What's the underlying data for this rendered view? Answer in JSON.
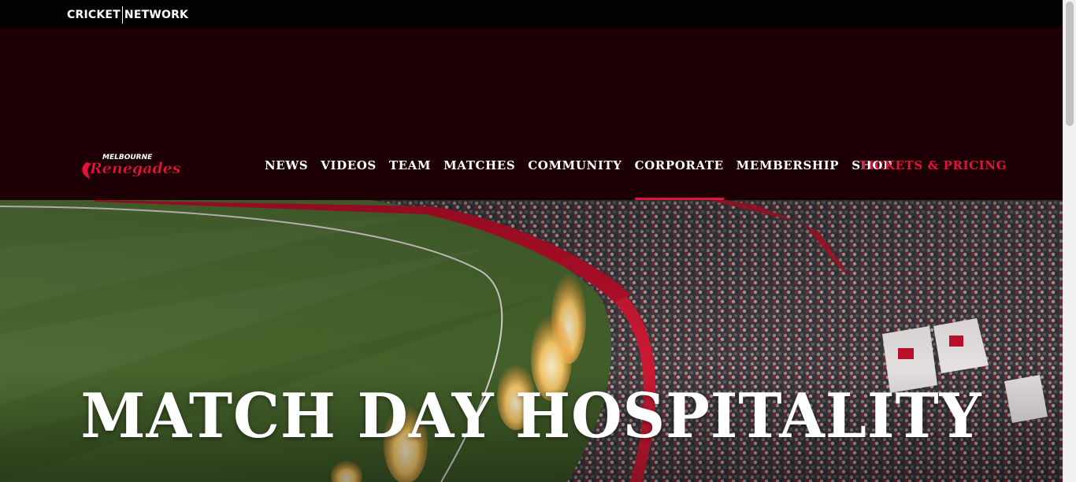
{
  "network_bar": {
    "logo_left": "CRICKET",
    "logo_right": "NETWORK"
  },
  "header": {
    "club_logo_top": "MELBOURNE",
    "club_logo_main": "Renegades",
    "nav": [
      {
        "label": "NEWS"
      },
      {
        "label": "VIDEOS"
      },
      {
        "label": "TEAM"
      },
      {
        "label": "MATCHES"
      },
      {
        "label": "COMMUNITY"
      },
      {
        "label": "CORPORATE",
        "active": true
      },
      {
        "label": "MEMBERSHIP"
      },
      {
        "label": "SHOP"
      }
    ],
    "tickets_label": "TICKETS & PRICING"
  },
  "hero": {
    "title": "MATCH DAY HOSPITALITY",
    "image_icon": "stadium-crowd-photo"
  },
  "colors": {
    "header_bg": "#1c0005",
    "network_bar_bg": "#030303",
    "accent_red": "#e5133b",
    "nav_text": "#ffffff"
  }
}
